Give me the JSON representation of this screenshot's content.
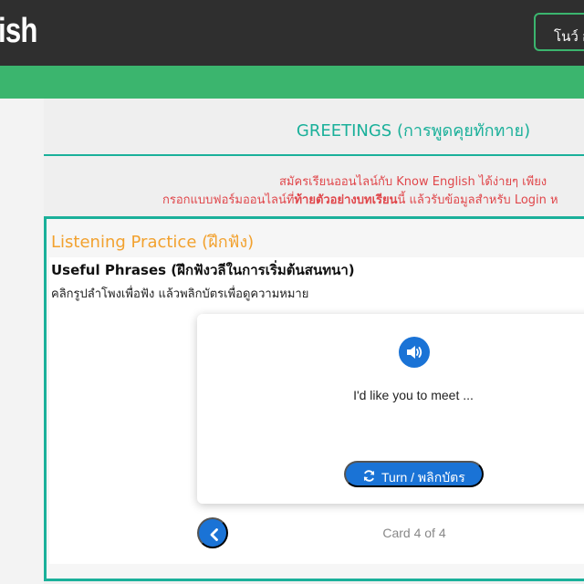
{
  "header": {
    "logo_text": "ish",
    "user_button_label": "โนว์ อั"
  },
  "lesson": {
    "title": "GREETINGS (การพูดคุยทักทาย)"
  },
  "signup_notice": {
    "line1": "สมัครเรียนออนไลน์กับ Know English ได้ง่ายๆ เพียง",
    "line2_before": "กรอกแบบฟอร์มออนไลน์ที่",
    "line2_bold": "ท้ายตัวอย่างบทเรียน",
    "line2_after": "นี้ แล้วรับข้อมูลสำหรับ Login ห"
  },
  "practice": {
    "title": "Listening Practice (ฝึกฟัง)",
    "subtitle": "Useful Phrases (ฝึกฟังวลีในการเริ่มต้นสนทนา)",
    "instruction": "คลิกรูปลำโพงเพื่อฟัง แล้วพลิกบัตรเพื่อดูความหมาย"
  },
  "card": {
    "speaker_icon": "volume-icon",
    "phrase": "I'd like you to meet ...",
    "turn_button_label": "Turn / พลิกบัตร",
    "turn_icon": "refresh-icon"
  },
  "pager": {
    "prev_icon": "chevron-left-icon",
    "counter": "Card 4 of 4"
  },
  "colors": {
    "topbar": "#2f2f2f",
    "green_bar": "#3bb56e",
    "teal_accent": "#1ab09a",
    "orange_title": "#f2a12e",
    "notice_red": "#e0464a",
    "primary_blue": "#1a73d6"
  }
}
